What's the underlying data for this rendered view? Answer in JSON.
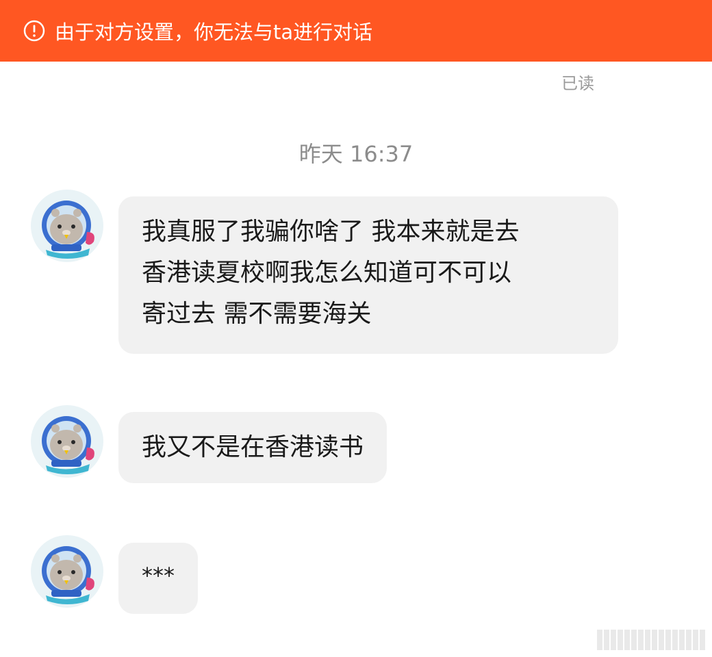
{
  "banner": {
    "text": "由于对方设置，你无法与ta进行对话",
    "icon": "alert-circle-icon",
    "color": "#ff5722"
  },
  "read_status": "已读",
  "timestamp": "昨天 16:37",
  "messages": [
    {
      "text": "我真服了我骗你啥了 我本来就是去香港读夏校啊我怎么知道可不可以寄过去 需不需要海关",
      "lines": [
        "我真服了我骗你啥了 我本来就是去",
        "香港读夏校啊我怎么知道可不可以",
        "寄过去 需不需要海关"
      ]
    },
    {
      "text": "我又不是在香港读书"
    },
    {
      "text": "***"
    }
  ],
  "avatar": {
    "icon": "seal-astronaut-avatar-icon"
  }
}
